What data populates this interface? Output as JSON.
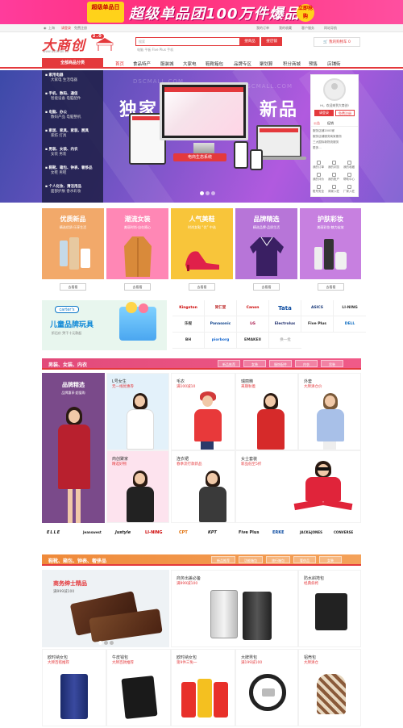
{
  "top_banner": {
    "tag": "超级单品日",
    "headline": "超级单品团100万件爆品",
    "cta": "立即抢购"
  },
  "util_bar": {
    "location": "上海",
    "login": "请登录",
    "register": "免费注册",
    "links": [
      "我的订单",
      "我的收藏",
      "客户服务",
      "网站导航"
    ]
  },
  "header": {
    "logo": "大商创",
    "logo_tag": "2.0",
    "logo_url": "www.dsomall.cn",
    "search_placeholder": "搜索",
    "search_button": "搜商品",
    "search_button2": "搜店铺",
    "hot_words": "电脑  平板  Five Plus  手机",
    "cart": "我的购物车 0"
  },
  "nav": {
    "category_label": "全部商品分类",
    "items": [
      "首页",
      "食品特产",
      "服装城",
      "大家电",
      "鞋靴箱包",
      "品牌专区",
      "聚划算",
      "积分商城",
      "预售",
      "店铺街"
    ]
  },
  "categories": [
    {
      "title": "家用电器",
      "sub": "大家电  生活电器"
    },
    {
      "title": "手机、数码、通信",
      "sub": "智能设备  电脑配件"
    },
    {
      "title": "电脑、办公",
      "sub": "数码产品  电脑整机"
    },
    {
      "title": "家居、家具、家装、厨具",
      "sub": "家纺  灯具"
    },
    {
      "title": "男装、女装、内衣",
      "sub": "女装  男装"
    },
    {
      "title": "鞋靴、箱包、钟表、奢侈品",
      "sub": "女鞋  男鞋"
    },
    {
      "title": "个人化妆、清洁用品",
      "sub": "面部护肤  香水彩妆"
    }
  ],
  "hero": {
    "left_text": "独家",
    "right_text": "新品",
    "watermark": "DSCMALL.COM",
    "label": "电商生态系统"
  },
  "user_panel": {
    "welcome": "Hi，欢迎来到大商创!",
    "login": "请登录",
    "register": "免费注册",
    "tabs": [
      "公告",
      "促销"
    ],
    "news": [
      "服务店铺2000家",
      "服务店铺服务商家服务",
      "三大国际新物流服务",
      "更多..."
    ],
    "icons": [
      "我的订单",
      "我的浏览",
      "我的收藏",
      "我的评价",
      "我的账户",
      "帮助中心",
      "账号安全",
      "商家入驻",
      "厂家入驻"
    ]
  },
  "promo_cards": [
    {
      "title": "优质新品",
      "sub": "精选优质·乐享生活",
      "button": "去看看",
      "color": "#f2a96a"
    },
    {
      "title": "潮流女装",
      "sub": "美丽时尚·自在随心",
      "button": "去看看",
      "color": "#ff87b5"
    },
    {
      "title": "人气美鞋",
      "sub": "时尚女鞋 “优” 中选",
      "button": "去看看",
      "color": "#f8c53a"
    },
    {
      "title": "品牌精选",
      "sub": "精选品牌·品质生活",
      "button": "去看看",
      "color": "#b775d8"
    },
    {
      "title": "护肤彩妆",
      "sub": "美丽彩妆·魅力绽放",
      "button": "去看看",
      "color": "#c780e0"
    }
  ],
  "kids_banner": {
    "brand": "carter's",
    "title": "儿童品牌玩具",
    "sub": "折后价 哭干十元款起"
  },
  "brands": [
    "Kingston",
    "同仁堂",
    "Canon",
    "Tata",
    "ASICS",
    "LI-NING",
    "乐视",
    "Panasonic",
    "LG",
    "Electrolux",
    "Five Plus",
    "DELL",
    "BH",
    "piorborg",
    "EMAKEII",
    "换一批"
  ],
  "floor1": {
    "title": "男装、女装、内衣",
    "tabs": [
      "新品推荐",
      "女装",
      "服饰配件",
      "内衣",
      "男装"
    ],
    "left": {
      "title": "品牌精选",
      "sub": "品牌惠享·超值购"
    },
    "cells": [
      {
        "name": "L号女生",
        "desc": "无一线优惠券"
      },
      {
        "name": "毛衣",
        "desc": "满100减10"
      },
      {
        "name": "瑞丽精",
        "desc": "来期秋着"
      },
      {
        "name": "外套",
        "desc": "大牌清仓价"
      },
      {
        "name": "商创聚家",
        "desc": "精选好物"
      },
      {
        "name": "连衣裙",
        "desc": "春季流行款新品"
      },
      {
        "name": "女士套装",
        "desc": "新品低至5折"
      }
    ],
    "logos": [
      "ELLE",
      "Jeanswest",
      "Justyle",
      "LI-NING",
      "CPT",
      "KPT",
      "Five Plus",
      "ERKE",
      "JACK&JONES",
      "CONVERSE"
    ]
  },
  "floor2": {
    "title": "鞋靴、箱包、钟表、奢侈品",
    "tabs": [
      "新品推荐",
      "功能箱包",
      "旅行箱包",
      "奢侈品",
      "女装"
    ],
    "left": {
      "title": "商务绅士精品",
      "sub": "满999减100"
    },
    "cells": [
      {
        "name": "商务出差必备",
        "desc": "满999减100"
      },
      {
        "name": "防水斜挎包",
        "desc": "经典斜挎"
      },
      {
        "name": "欧时纳女包",
        "desc": "大牌百搭推荐"
      },
      {
        "name": "牛皮钱包",
        "desc": "大牌百款推荐"
      },
      {
        "name": "欧时纳女包",
        "desc": "第9件三免一"
      },
      {
        "name": "大牌男包",
        "desc": "满199减100"
      },
      {
        "name": "铝壳包",
        "desc": "大牌清仓"
      }
    ]
  }
}
